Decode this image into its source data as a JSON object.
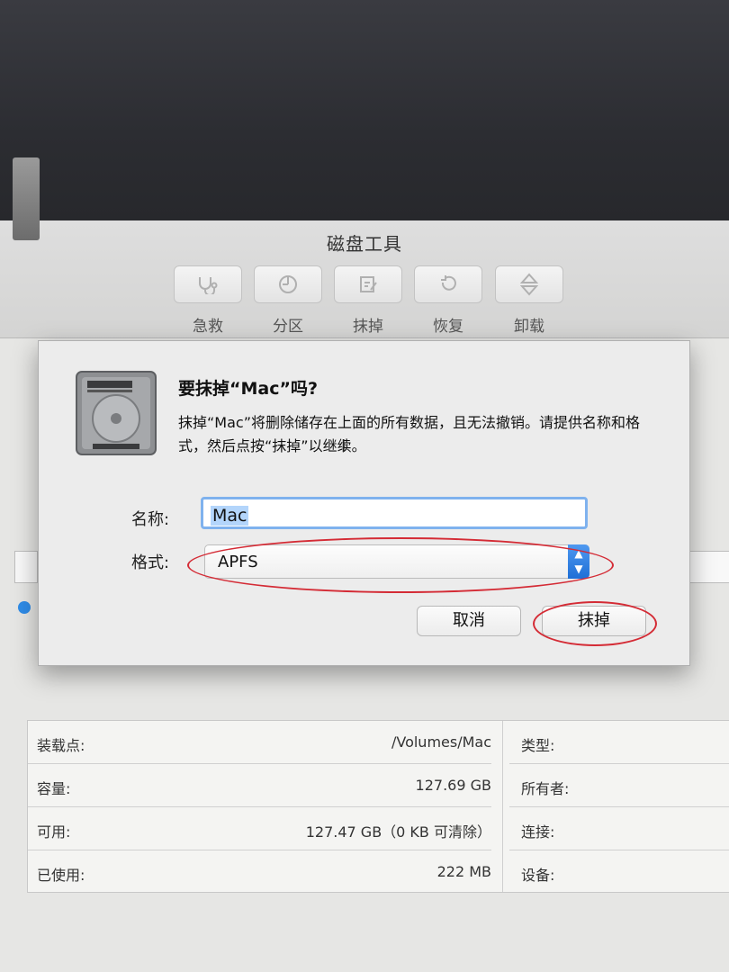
{
  "window": {
    "title": "磁盘工具"
  },
  "toolbar": {
    "items": [
      {
        "label": "急救",
        "icon": "stethoscope-icon"
      },
      {
        "label": "分区",
        "icon": "partition-icon"
      },
      {
        "label": "抹掉",
        "icon": "erase-icon"
      },
      {
        "label": "恢复",
        "icon": "restore-icon"
      },
      {
        "label": "卸载",
        "icon": "unmount-icon"
      }
    ]
  },
  "dialog": {
    "title": "要抹掉“Mac”吗?",
    "message": "抹掉“Mac”将删除储存在上面的所有数据，且无法撤销。请提供名称和格式，然后点按“抹掉”以继续。",
    "name_label": "名称:",
    "name_value": "Mac",
    "format_label": "格式:",
    "format_value": "APFS",
    "cancel_label": "取消",
    "erase_label": "抹掉"
  },
  "info": {
    "rows": [
      {
        "key": "装载点:",
        "value": "/Volumes/Mac",
        "key2": "类型:"
      },
      {
        "key": "容量:",
        "value": "127.69 GB",
        "key2": "所有者:"
      },
      {
        "key": "可用:",
        "value": "127.47 GB（0 KB 可清除）",
        "key2": "连接:"
      },
      {
        "key": "已使用:",
        "value": "222 MB",
        "key2": "设备:"
      }
    ]
  },
  "colors": {
    "accent": "#2f7be5",
    "annotation": "#d42b35"
  }
}
